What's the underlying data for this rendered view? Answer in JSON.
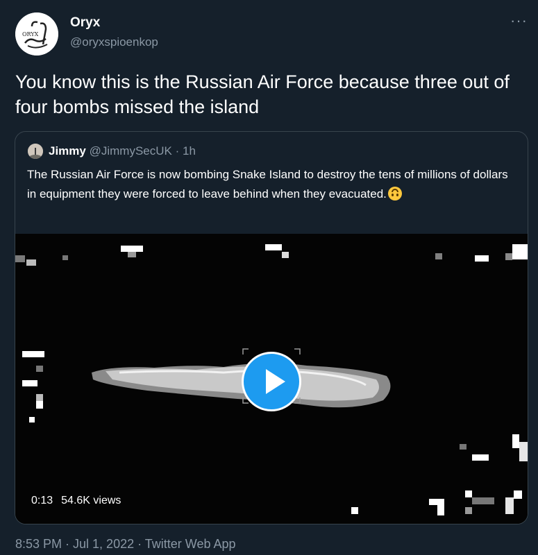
{
  "author": {
    "display_name": "Oryx",
    "handle": "@oryxspioenkop",
    "avatar_label": "ORYX"
  },
  "more_icon": "···",
  "tweet_text": "You know this is the Russian Air Force because three out of four bombs missed the island",
  "quoted": {
    "name": "Jimmy",
    "handle": "@JimmySecUK",
    "separator": "·",
    "time": "1h",
    "text": "The Russian Air Force is now bombing Snake Island to destroy the tens of millions of dollars in equipment they were forced to leave behind when they evacuated.",
    "emoji": "upside-down-face-emoji",
    "video": {
      "duration": "0:13",
      "views": "54.6K views"
    }
  },
  "footer": "8:53 PM · Jul 1, 2022 · Twitter Web App",
  "colors": {
    "background": "#15202b",
    "text": "#ffffff",
    "secondary_text": "#8b98a5",
    "border": "#38444d",
    "accent": "#1d9bf0"
  }
}
